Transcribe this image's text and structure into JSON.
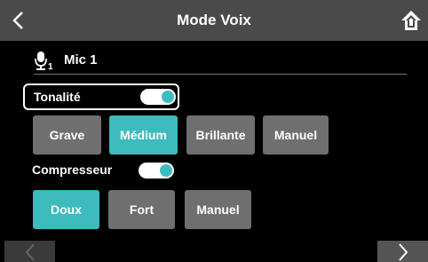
{
  "header": {
    "title": "Mode Voix",
    "back_icon": "chevron-left-icon",
    "home_icon": "home-icon"
  },
  "mic": {
    "icon": "microphone-1-icon",
    "label": "Mic 1"
  },
  "tone": {
    "label": "Tonalité",
    "enabled": true,
    "options": [
      "Grave",
      "Médium",
      "Brillante",
      "Manuel"
    ],
    "selected": "Médium"
  },
  "compressor": {
    "label": "Compresseur",
    "enabled": true,
    "options": [
      "Doux",
      "Fort",
      "Manuel"
    ],
    "selected": "Doux"
  },
  "nav": {
    "prev_icon": "chevron-left-icon",
    "next_icon": "chevron-right-icon"
  },
  "colors": {
    "accent": "#3dbbbd",
    "button": "#6f6f6f",
    "header": "#4a4a4a",
    "background": "#000000"
  }
}
